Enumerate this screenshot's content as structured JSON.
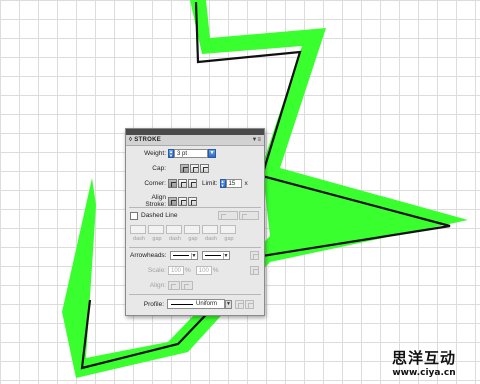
{
  "panel": {
    "tab_title": "◊ STROKE",
    "menu_icon": "panel-menu-icon",
    "weight_label": "Weight:",
    "weight_value": "3 pt",
    "cap_label": "Cap:",
    "corner_label": "Corner:",
    "limit_label": "Limit:",
    "limit_value": "15",
    "limit_unit": "x",
    "align_stroke_label": "Align Stroke:",
    "dashed_line_label": "Dashed Line",
    "dash_labels": [
      "dash",
      "gap",
      "dash",
      "gap",
      "dash",
      "gap"
    ],
    "arrowheads_label": "Arrowheads:",
    "scale_label": "Scale:",
    "scale_start": "100",
    "scale_end": "100",
    "scale_unit": "%",
    "align_label": "Align:",
    "profile_label": "Profile:",
    "profile_value": "Uniform"
  },
  "watermark": {
    "line1": "思洋互动",
    "line2": "www.ciya.cn"
  },
  "colors": {
    "stroke_green": "#39ff2e",
    "path_black": "#111111",
    "grid": "#dcdcdc"
  }
}
